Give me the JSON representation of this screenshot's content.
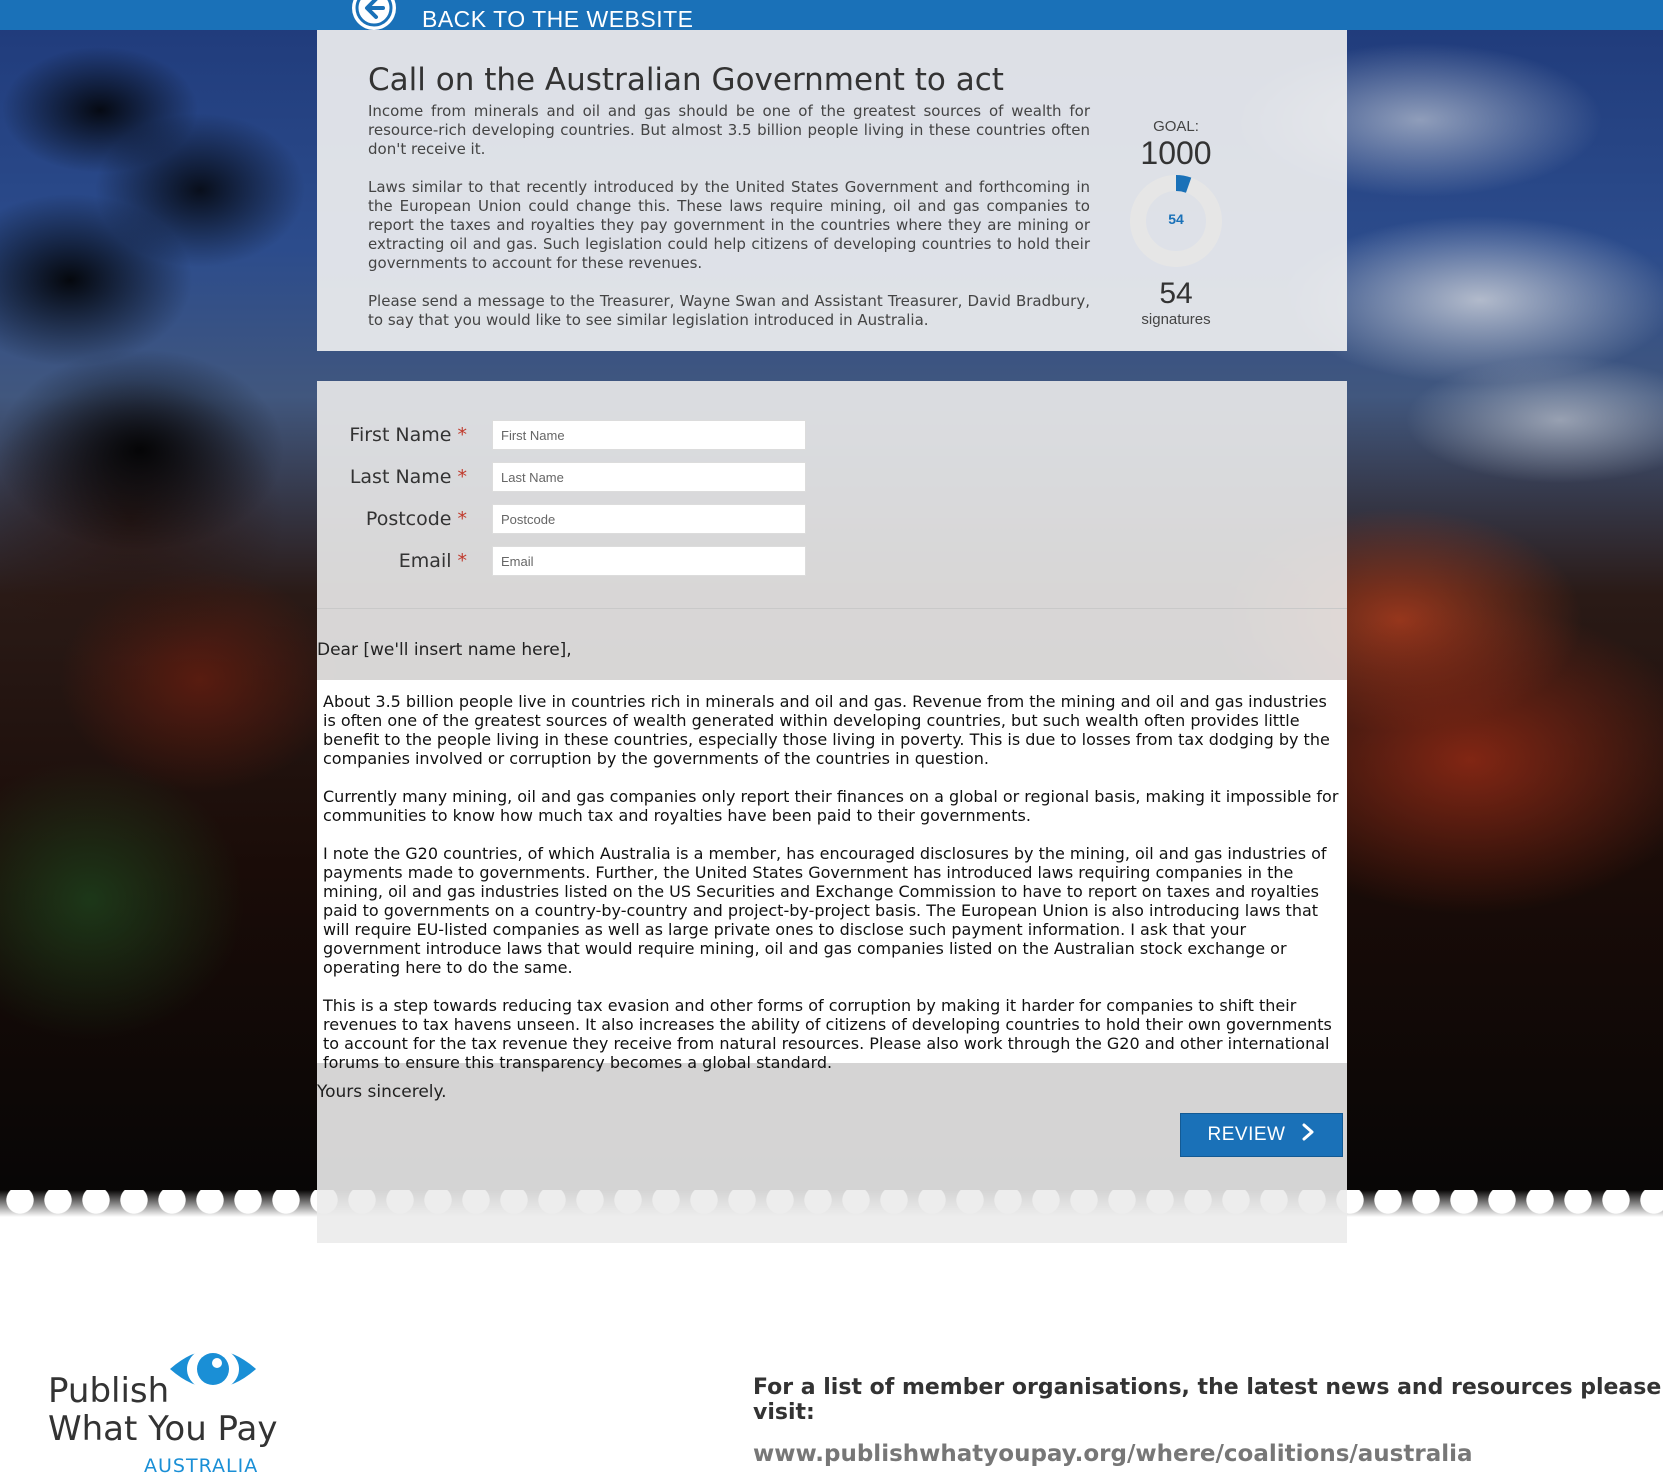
{
  "topbar": {
    "back_label": "BACK TO THE WEBSITE",
    "back_icon": "arrow-left-circle-icon",
    "color": "#1a71b8"
  },
  "intro": {
    "title": "Call on the Australian Government to act",
    "paragraphs": [
      "Income from minerals and oil and gas should be one of the greatest sources of wealth for resource-rich developing countries. But almost 3.5 billion people living in these countries often don't receive it.",
      "Laws similar to that recently introduced by the United States Government and forthcoming in the European Union could change this. These laws require mining, oil and gas companies to report the taxes and royalties they pay government in the countries where they are mining or extracting oil and gas. Such legislation could help citizens of developing countries to hold their governments to account for these revenues.",
      "Please send a message to the Treasurer, Wayne Swan and Assistant Treasurer, David Bradbury, to say that you would like to see similar legislation introduced in Australia."
    ],
    "goal_label": "GOAL:",
    "goal_value": "1000",
    "meter_count": "54",
    "meter_progress": 0.054,
    "signature_count": "54",
    "signature_label": "signatures"
  },
  "form": {
    "fields": [
      {
        "label": "First Name",
        "required_mark": "*",
        "placeholder": "First Name",
        "value": ""
      },
      {
        "label": "Last Name",
        "required_mark": "*",
        "placeholder": "Last Name",
        "value": ""
      },
      {
        "label": "Postcode",
        "required_mark": "*",
        "placeholder": "Postcode",
        "value": ""
      },
      {
        "label": "Email",
        "required_mark": "*",
        "placeholder": "Email",
        "value": ""
      }
    ]
  },
  "letter": {
    "salutation": "Dear [we'll insert name here],",
    "paragraphs": [
      "About 3.5 billion people live in countries rich in minerals and oil and gas.  Revenue from the mining and oil and gas industries is often one of the greatest sources of wealth generated within developing countries, but such wealth often provides little benefit to the people living in these countries, especially those living in poverty. This is due to losses from tax dodging by the companies involved or corruption by the governments of the countries in question.",
      "Currently many mining, oil and gas companies only report their finances on a global or regional basis, making it impossible for communities to know how much tax and royalties have been paid to their governments.",
      "I note the G20 countries, of which Australia is a member, has encouraged disclosures by the mining, oil and gas industries of payments made to governments. Further, the United States Government has introduced laws requiring companies in the mining, oil and gas industries listed on the US Securities and Exchange Commission to have to report on taxes and royalties paid to governments on a country-by-country and project-by-project basis. The European Union is also introducing laws that will require EU-listed companies as well as large private ones to disclose such payment information. I ask that your government introduce laws that would require mining, oil and gas companies listed on the Australian stock exchange or operating here to do the same.",
      "This is a step towards reducing tax evasion and other forms of corruption by making it harder for companies to shift their revenues to tax havens unseen. It also increases the ability of citizens of developing countries to hold their own governments to account for the tax revenue they receive from natural resources. Please also work through the G20 and other international forums to ensure this transparency becomes a global standard."
    ],
    "signoff": "Yours sincerely."
  },
  "actions": {
    "review_label": "REVIEW",
    "review_icon": "chevron-right-icon"
  },
  "footer": {
    "logo_line1": "Publish",
    "logo_line2": "What You Pay",
    "logo_line3": "AUSTRALIA",
    "logo_icon": "eye-icon",
    "lead": "For a list of member organisations, the latest news and resources please visit:",
    "url": "www.publishwhatyoupay.org/where/coalitions/australia"
  }
}
